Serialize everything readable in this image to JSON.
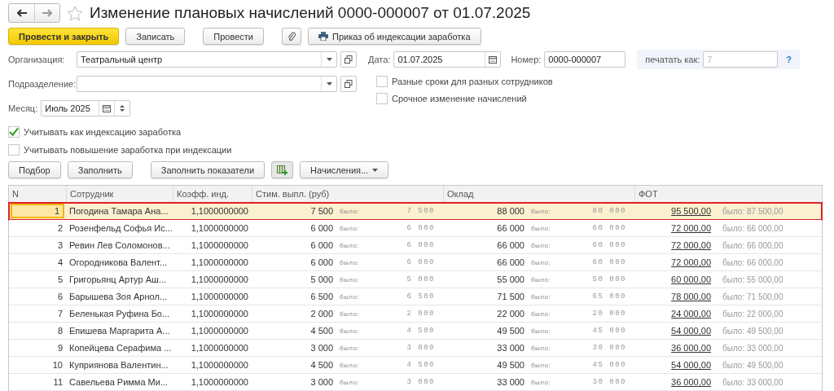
{
  "window": {
    "title": "Изменение плановых начислений 0000-000007 от 01.07.2025",
    "favorite": false
  },
  "toolbar": {
    "buttons": [
      {
        "label": "Провести и закрыть",
        "kind": "primary"
      },
      {
        "label": "Записать",
        "kind": "plain"
      },
      {
        "label": "Провести",
        "kind": "plain"
      },
      {
        "kind": "attach"
      },
      {
        "label": "Приказ об индексации заработка",
        "kind": "print"
      }
    ]
  },
  "form": {
    "organization": {
      "label": "Организация:",
      "value": "Театральный центр"
    },
    "department": {
      "label": "Подразделение:"
    },
    "date": {
      "label": "Дата:",
      "value": "01.07.2025"
    },
    "number": {
      "label": "Номер:",
      "value": "0000-000007"
    },
    "print_as": {
      "label": "печатать как:",
      "placeholder": "7",
      "help": "?"
    },
    "month": {
      "label": "Месяц:",
      "value": "Июль 2025"
    },
    "checks_right": [
      {
        "label": "Разные сроки для разных сотрудников",
        "checked": false
      },
      {
        "label": "Срочное изменение начислений",
        "checked": false
      }
    ],
    "checks_left": [
      {
        "label": "Учитывать как индексацию заработка",
        "checked": true
      },
      {
        "label": "Учитывать повышение заработка при индексации",
        "checked": false
      }
    ]
  },
  "table_toolbar": [
    {
      "label": "Подбор",
      "kind": "plain"
    },
    {
      "label": "Заполнить",
      "kind": "plain"
    },
    {
      "label": "Заполнить показатели",
      "kind": "plain"
    },
    {
      "kind": "grid"
    },
    {
      "label": "Начисления...",
      "kind": "menu"
    }
  ],
  "table": {
    "columns": [
      "N",
      "Сотрудник",
      "Коэфф. инд.",
      "Стим. выпл. (руб)",
      "Оклад",
      "ФОТ"
    ],
    "rows": [
      {
        "n": "1",
        "employee": "Погодина Тамара Ана...",
        "coeff": "1,1000000000",
        "stim": "7 500",
        "stim_was": {
          "label": "было:",
          "value": "7 500"
        },
        "salary": "88 000",
        "salary_was": {
          "label": "было:",
          "value": "80 000"
        },
        "fot": "95 500,00",
        "fot_was": {
          "label": "было:",
          "value": "87 500,00"
        },
        "selected": true
      },
      {
        "n": "2",
        "employee": "Розенфельд Софья Ис...",
        "coeff": "1,1000000000",
        "stim": "6 000",
        "stim_was": {
          "label": "было:",
          "value": "6 000"
        },
        "salary": "66 000",
        "salary_was": {
          "label": "было:",
          "value": "60 000"
        },
        "fot": "72 000,00",
        "fot_was": {
          "label": "было:",
          "value": "66 000,00"
        },
        "selected": false
      },
      {
        "n": "3",
        "employee": "Ревин Лев Соломонов...",
        "coeff": "1,1000000000",
        "stim": "6 000",
        "stim_was": {
          "label": "было:",
          "value": "6 000"
        },
        "salary": "66 000",
        "salary_was": {
          "label": "было:",
          "value": "60 000"
        },
        "fot": "72 000,00",
        "fot_was": {
          "label": "было:",
          "value": "66 000,00"
        },
        "selected": false
      },
      {
        "n": "4",
        "employee": "Огородникова Валент...",
        "coeff": "1,1000000000",
        "stim": "6 000",
        "stim_was": {
          "label": "было:",
          "value": "6 000"
        },
        "salary": "66 000",
        "salary_was": {
          "label": "было:",
          "value": "60 000"
        },
        "fot": "72 000,00",
        "fot_was": {
          "label": "было:",
          "value": "66 000,00"
        },
        "selected": false
      },
      {
        "n": "5",
        "employee": "Григорьянц Артур Аш...",
        "coeff": "1,1000000000",
        "stim": "5 000",
        "stim_was": {
          "label": "было:",
          "value": "5 000"
        },
        "salary": "55 000",
        "salary_was": {
          "label": "было:",
          "value": "50 000"
        },
        "fot": "60 000,00",
        "fot_was": {
          "label": "было:",
          "value": "55 000,00"
        },
        "selected": false
      },
      {
        "n": "6",
        "employee": "Барышева Зоя Арнол...",
        "coeff": "1,1000000000",
        "stim": "6 500",
        "stim_was": {
          "label": "было:",
          "value": "6 500"
        },
        "salary": "71 500",
        "salary_was": {
          "label": "было:",
          "value": "65 000"
        },
        "fot": "78 000,00",
        "fot_was": {
          "label": "было:",
          "value": "71 500,00"
        },
        "selected": false
      },
      {
        "n": "7",
        "employee": "Беленькая Руфина Бо...",
        "coeff": "1,1000000000",
        "stim": "2 000",
        "stim_was": {
          "label": "было:",
          "value": "2 000"
        },
        "salary": "22 000",
        "salary_was": {
          "label": "было:",
          "value": "20 000"
        },
        "fot": "24 000,00",
        "fot_was": {
          "label": "было:",
          "value": "22 000,00"
        },
        "selected": false
      },
      {
        "n": "8",
        "employee": "Епишева Маргарита А...",
        "coeff": "1,1000000000",
        "stim": "4 500",
        "stim_was": {
          "label": "было:",
          "value": "4 500"
        },
        "salary": "49 500",
        "salary_was": {
          "label": "было:",
          "value": "45 000"
        },
        "fot": "54 000,00",
        "fot_was": {
          "label": "было:",
          "value": "49 500,00"
        },
        "selected": false
      },
      {
        "n": "9",
        "employee": "Копейцева Серафима ...",
        "coeff": "1,1000000000",
        "stim": "3 000",
        "stim_was": {
          "label": "было:",
          "value": "3 000"
        },
        "salary": "33 000",
        "salary_was": {
          "label": "было:",
          "value": "30 000"
        },
        "fot": "36 000,00",
        "fot_was": {
          "label": "было:",
          "value": "33 000,00"
        },
        "selected": false
      },
      {
        "n": "10",
        "employee": "Куприянова Валентин...",
        "coeff": "1,1000000000",
        "stim": "4 500",
        "stim_was": {
          "label": "было:",
          "value": "4 500"
        },
        "salary": "49 500",
        "salary_was": {
          "label": "было:",
          "value": "45 000"
        },
        "fot": "54 000,00",
        "fot_was": {
          "label": "было:",
          "value": "49 500,00"
        },
        "selected": false
      },
      {
        "n": "11",
        "employee": "Савельева Римма Ми...",
        "coeff": "1,1000000000",
        "stim": "3 000",
        "stim_was": {
          "label": "было:",
          "value": "3 000"
        },
        "salary": "33 000",
        "salary_was": {
          "label": "было:",
          "value": "30 000"
        },
        "fot": "36 000,00",
        "fot_was": {
          "label": "было:",
          "value": "33 000,00"
        },
        "selected": false
      }
    ]
  }
}
